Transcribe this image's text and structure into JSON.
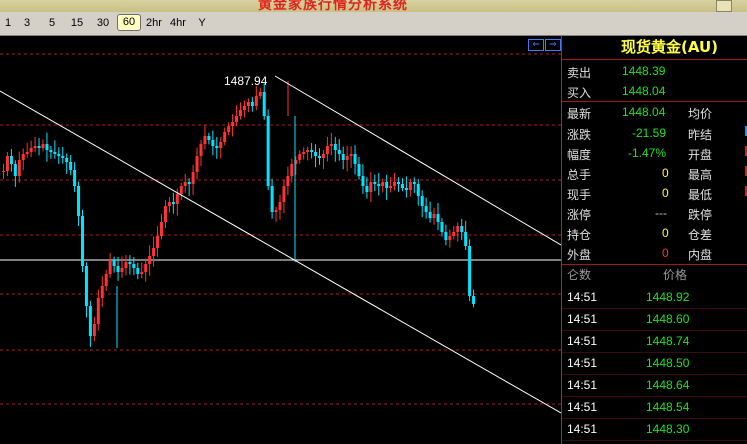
{
  "window": {
    "title": "黄金家族行情分析系统"
  },
  "toolbar": {
    "periods": [
      "1",
      "3",
      "5",
      "15",
      "30",
      "60",
      "2hr",
      "4hr",
      "Y"
    ],
    "active": "60"
  },
  "chart": {
    "high_label": "1487.94",
    "colors": {
      "up": "#ff3333",
      "down": "#00e5ff",
      "trendline": "#ffffff",
      "grid": "#b01e1e"
    }
  },
  "quote": {
    "nav_left_icon": "left-arrow-icon",
    "nav_right_icon": "right-arrow-icon",
    "instrument": "现货黄金(AU)",
    "sell_label": "卖出",
    "sell": "1448.39",
    "buy_label": "买入",
    "buy": "1448.04",
    "last_label": "最新",
    "last": "1448.04",
    "avg_label": "均价",
    "change_label": "涨跌",
    "change": "-21.59",
    "prev_close_label": "昨结",
    "pct_label": "幅度",
    "pct": "-1.47%",
    "open_label": "开盘",
    "total_label": "总手",
    "total": "0",
    "high_label": "最高",
    "vol_label": "现手",
    "vol": "0",
    "low_label": "最低",
    "limit_up_label": "涨停",
    "limit_up": "---",
    "limit_down_label": "跌停",
    "oi_label": "持仓",
    "oi": "0",
    "oi_diff_label": "仓差",
    "outer_label": "外盘",
    "outer": "0",
    "inner_label": "内盘"
  },
  "ticks": {
    "header_qty": "仑数",
    "header_price": "价格",
    "rows": [
      {
        "time": "14:51",
        "price": "1448.92"
      },
      {
        "time": "14:51",
        "price": "1448.60"
      },
      {
        "time": "14:51",
        "price": "1448.74"
      },
      {
        "time": "14:51",
        "price": "1448.50"
      },
      {
        "time": "14:51",
        "price": "1448.64"
      },
      {
        "time": "14:51",
        "price": "1448.54"
      },
      {
        "time": "14:51",
        "price": "1448.30"
      }
    ]
  }
}
